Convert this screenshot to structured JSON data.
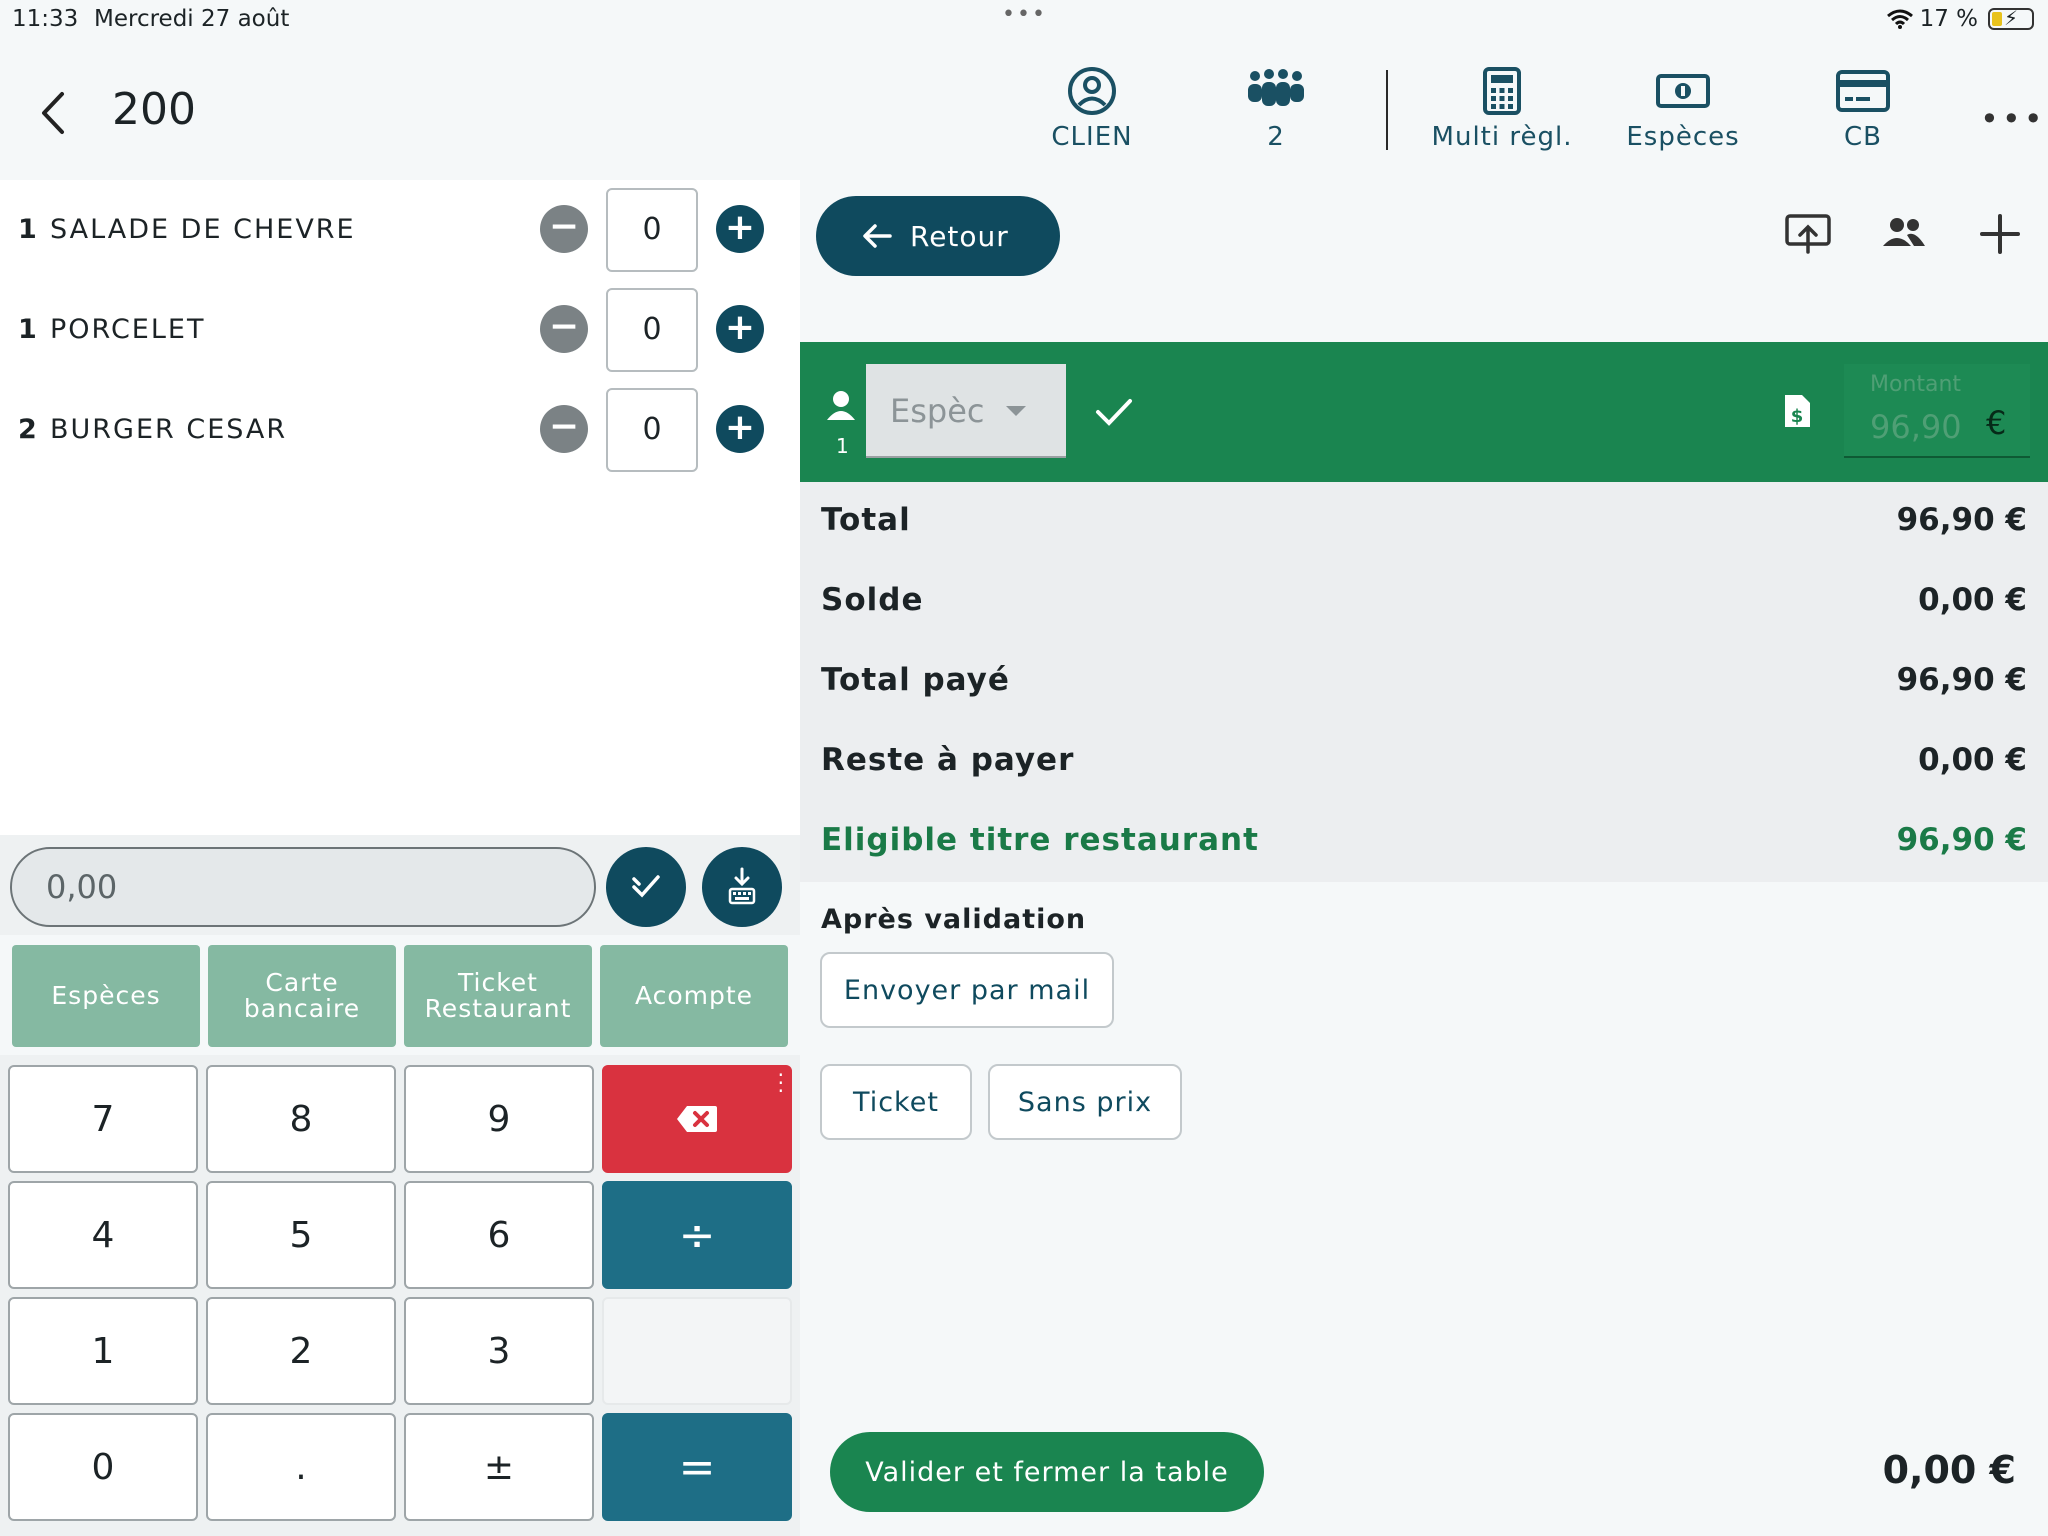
{
  "status": {
    "time": "11:33",
    "date": "Mercredi 27 août",
    "battery": "17 %"
  },
  "header": {
    "order_number": "200",
    "tools": {
      "client": "CLIEN",
      "covers": "2",
      "multi": "Multi règl.",
      "cash": "Espèces",
      "card": "CB"
    }
  },
  "items": [
    {
      "qty": "1",
      "name": "SALADE DE CHEVRE",
      "value": "0"
    },
    {
      "qty": "1",
      "name": "PORCELET",
      "value": "0"
    },
    {
      "qty": "2",
      "name": "BURGER CESAR",
      "value": "0"
    }
  ],
  "amount_input": {
    "value": "0,00"
  },
  "payment_methods": [
    "Espèces",
    "Carte bancaire",
    "Ticket Restaurant",
    "Acompte"
  ],
  "keypad": {
    "k7": "7",
    "k8": "8",
    "k9": "9",
    "k4": "4",
    "k5": "5",
    "k6": "6",
    "k1": "1",
    "k2": "2",
    "k3": "3",
    "k0": "0",
    "dot": ".",
    "plusminus": "±",
    "divide": "÷",
    "equals": "="
  },
  "retour_label": "Retour",
  "payment_line": {
    "person_number": "1",
    "method": "Espèc",
    "amount_label": "Montant",
    "amount_value": "96,90",
    "currency": "€"
  },
  "totals": [
    {
      "label": "Total",
      "value": "96,90 €"
    },
    {
      "label": "Solde",
      "value": "0,00 €"
    },
    {
      "label": "Total payé",
      "value": "96,90 €"
    },
    {
      "label": "Reste à payer",
      "value": "0,00 €"
    },
    {
      "label": "Eligible titre restaurant",
      "value": "96,90 €"
    }
  ],
  "after_validation": {
    "title": "Après validation",
    "send_mail": "Envoyer par mail",
    "ticket": "Ticket",
    "no_price": "Sans prix"
  },
  "validate_label": "Valider et fermer la table",
  "bottom_total": "0,00 €",
  "colors": {
    "primary_dark": "#0f4a5e",
    "green": "#1a8550",
    "method_green": "#85b9a2",
    "delete_red": "#d9323f",
    "operator_blue": "#1e6e86"
  }
}
